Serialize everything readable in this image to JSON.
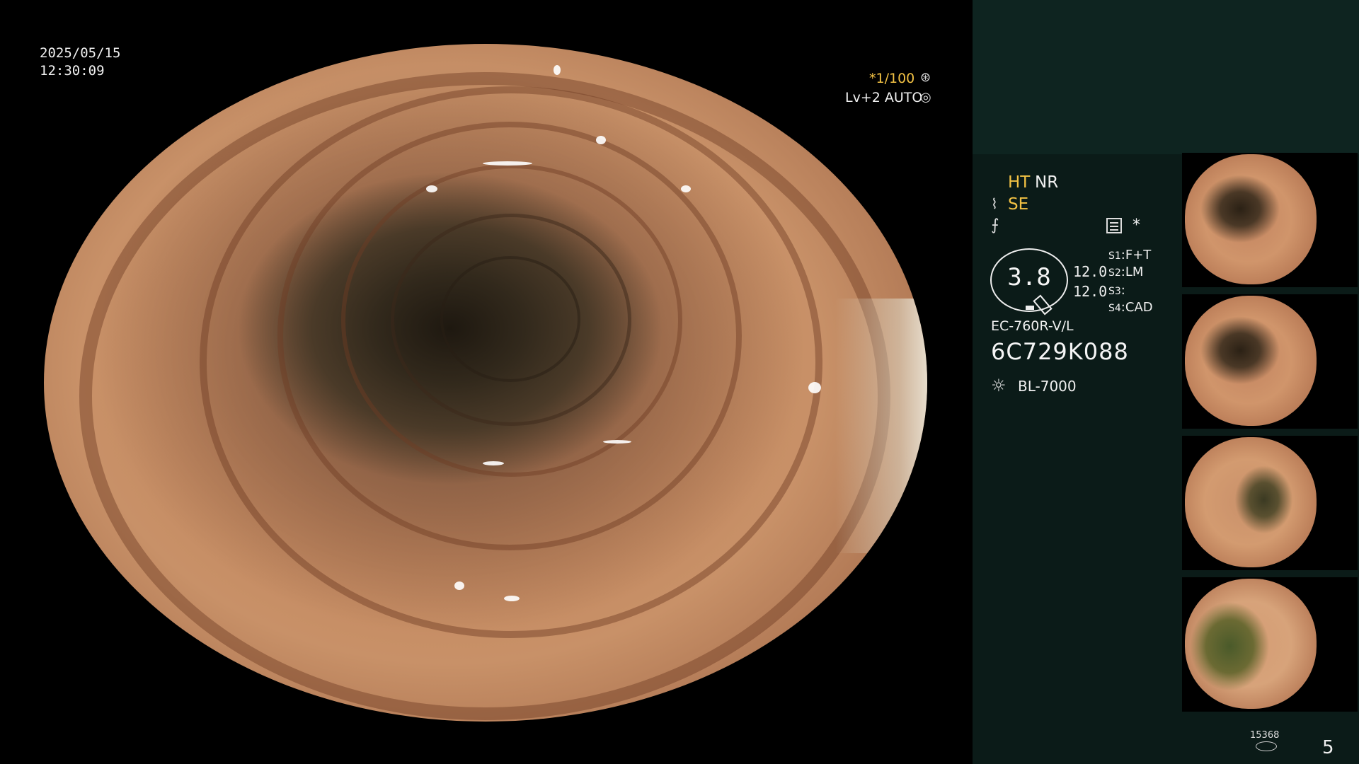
{
  "overlay": {
    "date": "2025/05/15",
    "time": "12:30:09",
    "shutter": "*1/100",
    "level": "Lv+2 AUTO"
  },
  "panel": {
    "ht": "HT",
    "nr": "NR",
    "se": "SE",
    "star": "*",
    "zoom": "3.8",
    "value1": "12.0",
    "value2": "12.0",
    "slots": [
      {
        "key": "S1",
        "value": "F+T"
      },
      {
        "key": "S2",
        "value": "LM"
      },
      {
        "key": "S3",
        "value": ""
      },
      {
        "key": "S4",
        "value": "CAD"
      }
    ],
    "scope_model": "EC-760R-V/L",
    "scope_serial": "6C729K088",
    "light_source": "BL-7000"
  },
  "footer": {
    "counter": "15368",
    "page": "5"
  },
  "colors": {
    "accent": "#f3c244",
    "panel_bg": "#0b1b18",
    "panel_top": "#0e2420"
  },
  "icons": [
    "shutter-icon",
    "auto-icon",
    "structure-enhance-icon",
    "color-filter-icon",
    "document-icon",
    "light-source-icon",
    "counter-icon"
  ]
}
